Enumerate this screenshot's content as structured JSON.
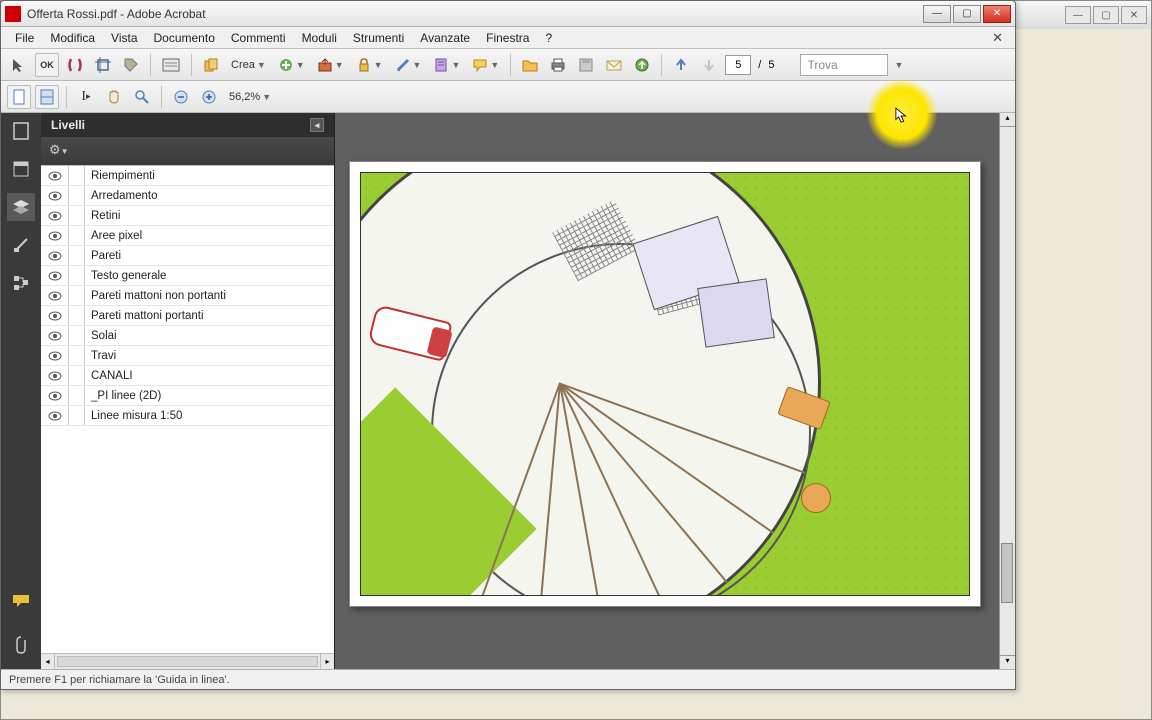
{
  "app": {
    "title": "Offerta Rossi.pdf - Adobe Acrobat"
  },
  "menu": {
    "items": [
      "File",
      "Modifica",
      "Vista",
      "Documento",
      "Commenti",
      "Moduli",
      "Strumenti",
      "Avanzate",
      "Finestra",
      "?"
    ]
  },
  "toolbar": {
    "crea_label": "Crea",
    "page_current": "5",
    "page_sep": "/",
    "page_total": "5",
    "find_placeholder": "Trova",
    "zoom_value": "56,2%"
  },
  "panel": {
    "title": "Livelli",
    "layers": [
      "Riempimenti",
      "Arredamento",
      "Retini",
      "Aree pixel",
      "Pareti",
      "Testo generale",
      "Pareti mattoni non portanti",
      "Pareti mattoni portanti",
      "Solai",
      "Travi",
      "CANALI",
      "_PI linee (2D)",
      "Linee misura 1:50"
    ]
  },
  "status": {
    "text": "Premere F1 per richiamare la 'Guida in linea'."
  },
  "colors": {
    "accent_red": "#cc0000",
    "grass": "#9acd32",
    "highlight": "#ffe500"
  }
}
